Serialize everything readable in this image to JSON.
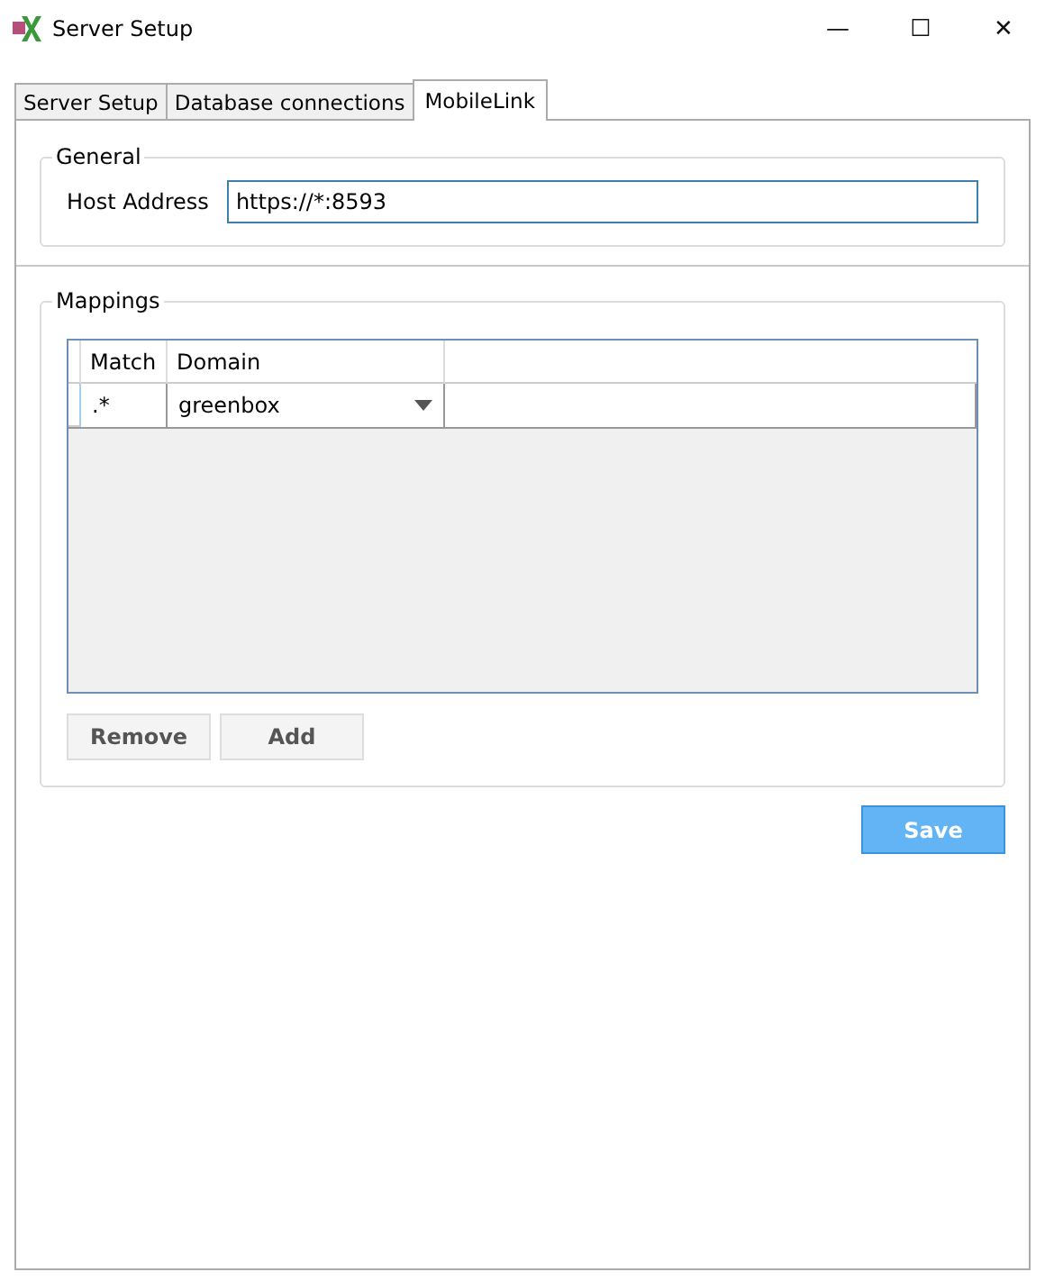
{
  "window": {
    "title": "Server Setup",
    "controls": [
      "—",
      "☐",
      "✕"
    ]
  },
  "tabs": [
    {
      "label": "Server Setup",
      "selected": false
    },
    {
      "label": "Database connections",
      "selected": false
    },
    {
      "label": "MobileLink",
      "selected": true
    }
  ],
  "general": {
    "title": "General",
    "host_label": "Host Address",
    "host_value": "https://*:8593"
  },
  "mappings": {
    "title": "Mappings",
    "columns": [
      "Match",
      "Domain"
    ],
    "rows": [
      {
        "match": ".*",
        "domain": "greenbox"
      }
    ],
    "buttons": [
      "Remove",
      "Add"
    ]
  },
  "save_button": "Save"
}
